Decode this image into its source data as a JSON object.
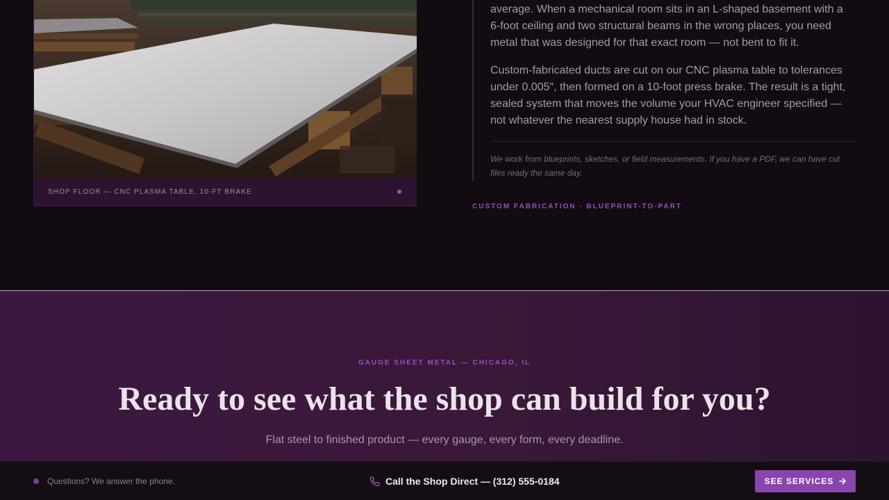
{
  "feature": {
    "photo_caption": "SHOP FLOOR — CNC PLASMA TABLE, 10-FT BRAKE",
    "paragraph_1": "average. When a mechanical room sits in an L-shaped basement with a 6-foot ceiling and two structural beams in the wrong places, you need metal that was designed for that exact room — not bent to fit it.",
    "paragraph_2": "Custom-fabricated ducts are cut on our CNC plasma table to tolerances under 0.005″, then formed on a 10-foot press brake. The result is a tight, sealed system that moves the volume your HVAC engineer specified — not whatever the nearest supply house had in stock.",
    "note": "We work from blueprints, sketches, or field measurements. If you have a PDF, we can have cut files ready the same day.",
    "tagline": "CUSTOM FABRICATION · BLUEPRINT-TO-PART"
  },
  "cta": {
    "eyebrow": "GAUGE SHEET METAL — CHICAGO, IL",
    "title": "Ready to see what the shop can build for you?",
    "subtitle": "Flat steel to finished product — every gauge, every form, every deadline."
  },
  "bottom_bar": {
    "left_text": "Questions? We answer the phone.",
    "call_text": "Call the Shop Direct — (312) 555-0184",
    "button_label": "SEE SERVICES",
    "icons": {
      "phone": "phone-icon",
      "arrow": "arrow-right-icon"
    }
  },
  "colors": {
    "accent": "#9b4fbf",
    "background": "#120b11",
    "cta_background": "#3c1840",
    "button": "#8a45ad"
  }
}
